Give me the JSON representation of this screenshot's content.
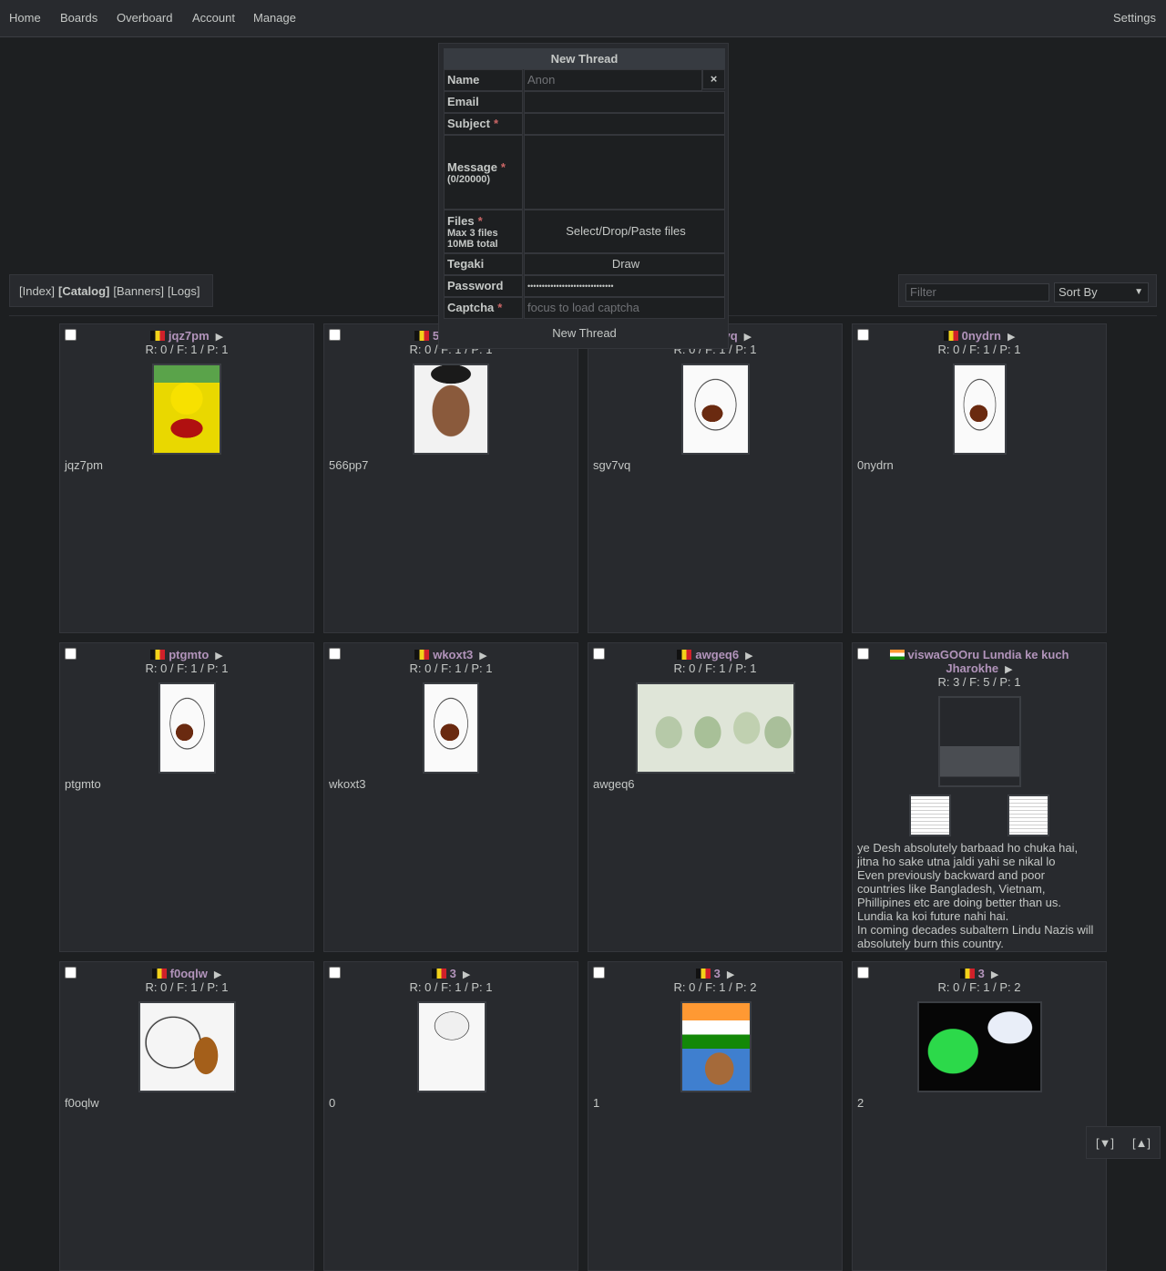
{
  "nav": {
    "home": "Home",
    "boards": "Boards",
    "overboard": "Overboard",
    "account": "Account",
    "manage": "Manage",
    "settings": "Settings"
  },
  "controls": {
    "index": "[Index]",
    "catalog": "[Catalog]",
    "banners": "[Banners]",
    "logs": "[Logs]"
  },
  "filter": {
    "placeholder": "Filter",
    "sort_label": "Sort By"
  },
  "form": {
    "title": "New Thread",
    "name_label": "Name",
    "name_placeholder": "Anon",
    "close": "×",
    "email_label": "Email",
    "subject_label": "Subject",
    "message_label": "Message",
    "message_counter": "(0/20000)",
    "files_label": "Files",
    "files_limit": "Max 3 files",
    "files_size": "10MB total",
    "files_button": "Select/Drop/Paste files",
    "tegaki_label": "Tegaki",
    "tegaki_button": "Draw",
    "password_label": "Password",
    "password_value": "••••••••••••••••••••••••••••••",
    "captcha_label": "Captcha",
    "captcha_placeholder": "focus to load captcha",
    "submit": "New Thread",
    "required_mark": "*"
  },
  "threads": [
    {
      "subject": "jqz7pm",
      "stats": "R: 0 / F: 1 / P: 1",
      "text": "jqz7pm",
      "flag": "be"
    },
    {
      "subject": "566pp7",
      "stats": "R: 0 / F: 1 / P: 1",
      "text": "566pp7",
      "flag": "be"
    },
    {
      "subject": "sgv7vq",
      "stats": "R: 0 / F: 1 / P: 1",
      "text": "sgv7vq",
      "flag": "be"
    },
    {
      "subject": "0nydrn",
      "stats": "R: 0 / F: 1 / P: 1",
      "text": "0nydrn",
      "flag": "be"
    },
    {
      "subject": "ptgmto",
      "stats": "R: 0 / F: 1 / P: 1",
      "text": "ptgmto",
      "flag": "be"
    },
    {
      "subject": "wkoxt3",
      "stats": "R: 0 / F: 1 / P: 1",
      "text": "wkoxt3",
      "flag": "be"
    },
    {
      "subject": "awgeq6",
      "stats": "R: 0 / F: 1 / P: 1",
      "text": "awgeq6",
      "flag": "be"
    },
    {
      "subject": "viswaGOOru Lundia ke kuch Jharokhe",
      "stats": "R: 3 / F: 5 / P: 1",
      "flag": "in",
      "lines": [
        "ye Desh absolutely barbaad ho chuka hai,",
        "jitna ho sake utna jaldi yahi se nikal lo",
        "Even previously backward and poor",
        "countries like Bangladesh, Vietnam,",
        "Phillipines etc are doing better than us.",
        "Lundia ka koi future nahi hai.",
        "In coming decades subaltern Lindu Nazis will",
        "absolutely burn this country."
      ]
    },
    {
      "subject": "f0oqlw",
      "stats": "R: 0 / F: 1 / P: 1",
      "text": "f0oqlw",
      "flag": "be"
    },
    {
      "subject": "3",
      "stats": "R: 0 / F: 1 / P: 1",
      "text": "0",
      "flag": "be"
    },
    {
      "subject": "3",
      "stats": "R: 0 / F: 1 / P: 2",
      "text": "1",
      "flag": "be"
    },
    {
      "subject": "3",
      "stats": "R: 0 / F: 1 / P: 2",
      "text": "2",
      "flag": "be"
    }
  ],
  "jump": {
    "down": "[▼]",
    "up": "[▲]"
  }
}
